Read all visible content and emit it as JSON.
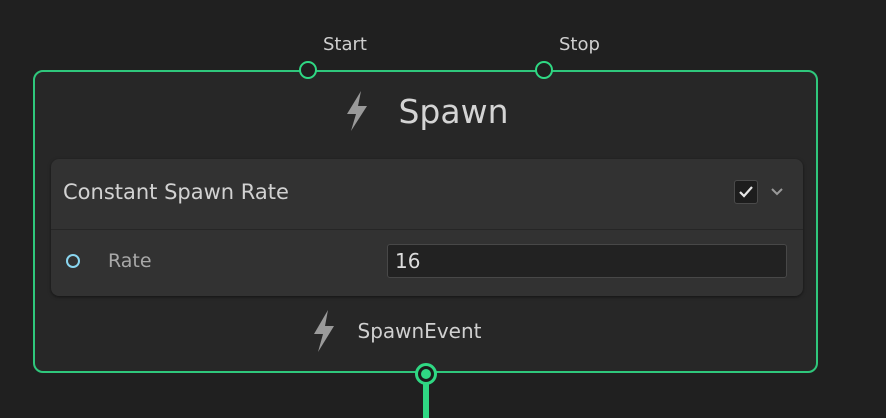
{
  "node": {
    "title": "Spawn",
    "title_icon": "lightning-bolt-icon",
    "inputs": {
      "start_label": "Start",
      "stop_label": "Stop"
    },
    "block": {
      "title": "Constant Spawn Rate",
      "enabled": true,
      "properties": [
        {
          "label": "Rate",
          "value": "16"
        }
      ]
    },
    "output": {
      "label": "SpawnEvent",
      "icon": "lightning-bolt-icon"
    }
  },
  "colors": {
    "background": "#202020",
    "node_border": "#2fc77c",
    "flow_port": "#2fd883",
    "property_port": "#8ad6f0"
  }
}
